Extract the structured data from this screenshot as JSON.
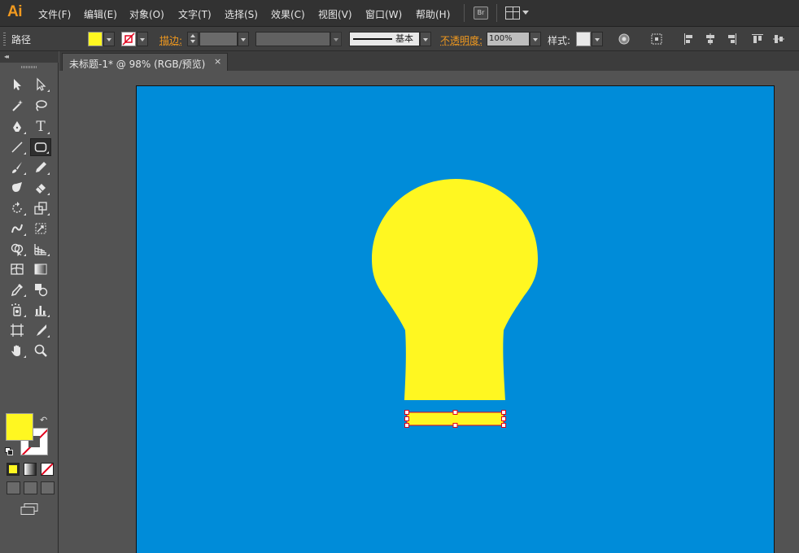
{
  "app": {
    "logo": "Ai"
  },
  "menubar": {
    "items": [
      "文件(F)",
      "编辑(E)",
      "对象(O)",
      "文字(T)",
      "选择(S)",
      "效果(C)",
      "视图(V)",
      "窗口(W)",
      "帮助(H)"
    ],
    "bridge_label": "Br"
  },
  "controlbar": {
    "selection_type": "路径",
    "stroke_label": "描边:",
    "brush_label": "基本",
    "opacity_label": "不透明度:",
    "opacity_value": "100%",
    "style_label": "样式:"
  },
  "document": {
    "tab_title": "未标题-1* @ 98% (RGB/预览)",
    "close_glyph": "×"
  },
  "colors": {
    "fill": "#fff721",
    "artboard_bg": "#008cd9",
    "accent": "#f29a1f",
    "stroke_none": "#e0001a",
    "selection": "#e0001a"
  },
  "tools": [
    {
      "name": "selection-tool-icon"
    },
    {
      "name": "direct-selection-tool-icon"
    },
    {
      "name": "magic-wand-tool-icon"
    },
    {
      "name": "lasso-tool-icon"
    },
    {
      "name": "pen-tool-icon"
    },
    {
      "name": "type-tool-icon",
      "glyph": "T"
    },
    {
      "name": "line-segment-tool-icon"
    },
    {
      "name": "rounded-rectangle-tool-icon",
      "active": true
    },
    {
      "name": "paintbrush-tool-icon"
    },
    {
      "name": "pencil-tool-icon"
    },
    {
      "name": "blob-brush-tool-icon"
    },
    {
      "name": "eraser-tool-icon"
    },
    {
      "name": "rotate-tool-icon"
    },
    {
      "name": "scale-tool-icon"
    },
    {
      "name": "warp-tool-icon"
    },
    {
      "name": "free-transform-tool-icon"
    },
    {
      "name": "shape-builder-tool-icon"
    },
    {
      "name": "perspective-grid-tool-icon"
    },
    {
      "name": "mesh-tool-icon"
    },
    {
      "name": "gradient-tool-icon"
    },
    {
      "name": "eyedropper-tool-icon"
    },
    {
      "name": "blend-tool-icon"
    },
    {
      "name": "symbol-sprayer-tool-icon"
    },
    {
      "name": "column-graph-tool-icon"
    },
    {
      "name": "artboard-tool-icon"
    },
    {
      "name": "slice-tool-icon"
    },
    {
      "name": "hand-tool-icon"
    },
    {
      "name": "zoom-tool-icon"
    }
  ]
}
